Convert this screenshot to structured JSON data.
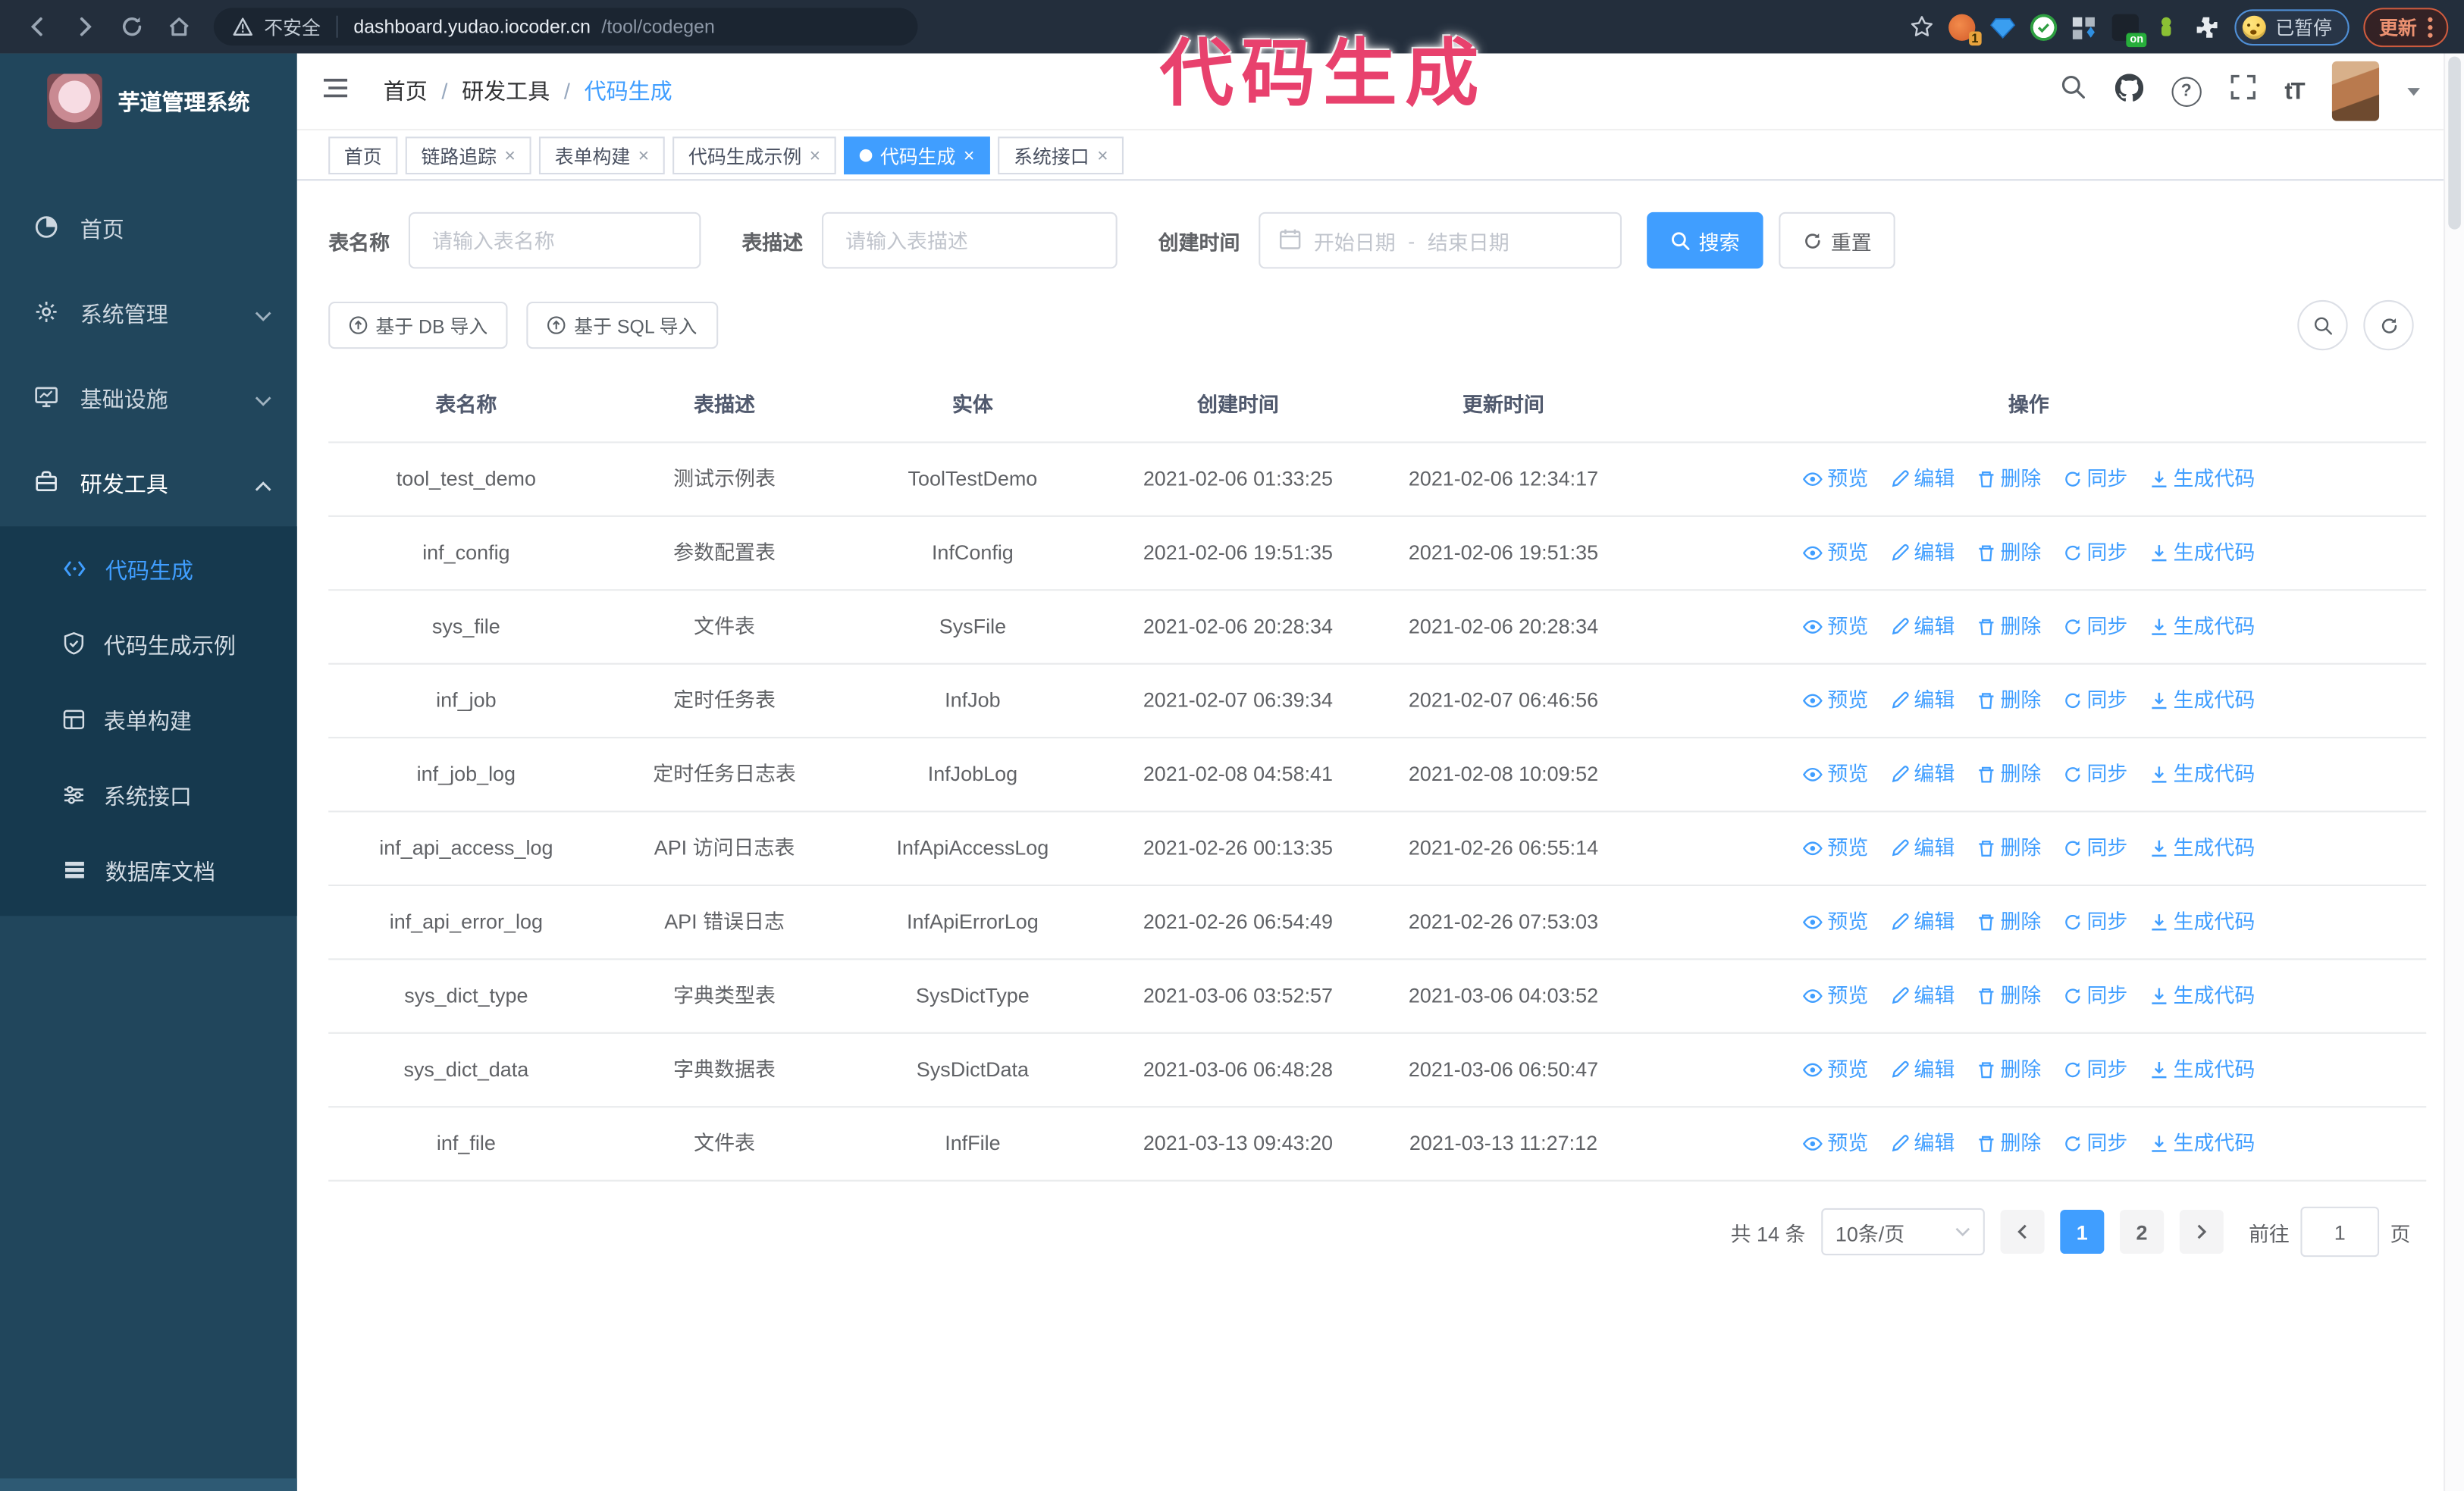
{
  "browser": {
    "security_warning": "不安全",
    "url_domain": "dashboard.yudao.iocoder.cn",
    "url_path": "/tool/codegen",
    "extension_badge": "1",
    "extension_on_label": "on",
    "paused_badge": "已暂停",
    "update_button": "更新"
  },
  "watermark": "代码生成",
  "sidebar": {
    "app_title": "芋道管理系统",
    "items": [
      {
        "label": "首页"
      },
      {
        "label": "系统管理"
      },
      {
        "label": "基础设施"
      },
      {
        "label": "研发工具"
      }
    ],
    "submenu": [
      {
        "label": "代码生成"
      },
      {
        "label": "代码生成示例"
      },
      {
        "label": "表单构建"
      },
      {
        "label": "系统接口"
      },
      {
        "label": "数据库文档"
      }
    ]
  },
  "header": {
    "breadcrumb": [
      "首页",
      "研发工具",
      "代码生成"
    ],
    "breadcrumb_separator": "/",
    "font_size_icon_text": "tT",
    "help_glyph": "?"
  },
  "tabs": {
    "close_glyph": "×",
    "items": [
      {
        "label": "首页"
      },
      {
        "label": "链路追踪"
      },
      {
        "label": "表单构建"
      },
      {
        "label": "代码生成示例"
      },
      {
        "label": "代码生成"
      },
      {
        "label": "系统接口"
      }
    ]
  },
  "filters": {
    "table_name_label": "表名称",
    "table_name_placeholder": "请输入表名称",
    "table_desc_label": "表描述",
    "table_desc_placeholder": "请输入表描述",
    "create_time_label": "创建时间",
    "date_start_placeholder": "开始日期",
    "date_separator": "-",
    "date_end_placeholder": "结束日期",
    "search_button": "搜索",
    "reset_button": "重置"
  },
  "toolbar": {
    "import_db": "基于 DB 导入",
    "import_sql": "基于 SQL 导入"
  },
  "table": {
    "columns": [
      "表名称",
      "表描述",
      "实体",
      "创建时间",
      "更新时间",
      "操作"
    ],
    "actions": [
      "预览",
      "编辑",
      "删除",
      "同步",
      "生成代码"
    ],
    "rows": [
      {
        "name": "tool_test_demo",
        "desc": "测试示例表",
        "entity": "ToolTestDemo",
        "created": "2021-02-06 01:33:25",
        "updated": "2021-02-06 12:34:17"
      },
      {
        "name": "inf_config",
        "desc": "参数配置表",
        "entity": "InfConfig",
        "created": "2021-02-06 19:51:35",
        "updated": "2021-02-06 19:51:35"
      },
      {
        "name": "sys_file",
        "desc": "文件表",
        "entity": "SysFile",
        "created": "2021-02-06 20:28:34",
        "updated": "2021-02-06 20:28:34"
      },
      {
        "name": "inf_job",
        "desc": "定时任务表",
        "entity": "InfJob",
        "created": "2021-02-07 06:39:34",
        "updated": "2021-02-07 06:46:56"
      },
      {
        "name": "inf_job_log",
        "desc": "定时任务日志表",
        "entity": "InfJobLog",
        "created": "2021-02-08 04:58:41",
        "updated": "2021-02-08 10:09:52"
      },
      {
        "name": "inf_api_access_log",
        "desc": "API 访问日志表",
        "entity": "InfApiAccessLog",
        "created": "2021-02-26 00:13:35",
        "updated": "2021-02-26 06:55:14"
      },
      {
        "name": "inf_api_error_log",
        "desc": "API 错误日志",
        "entity": "InfApiErrorLog",
        "created": "2021-02-26 06:54:49",
        "updated": "2021-02-26 07:53:03"
      },
      {
        "name": "sys_dict_type",
        "desc": "字典类型表",
        "entity": "SysDictType",
        "created": "2021-03-06 03:52:57",
        "updated": "2021-03-06 04:03:52"
      },
      {
        "name": "sys_dict_data",
        "desc": "字典数据表",
        "entity": "SysDictData",
        "created": "2021-03-06 06:48:28",
        "updated": "2021-03-06 06:50:47"
      },
      {
        "name": "inf_file",
        "desc": "文件表",
        "entity": "InfFile",
        "created": "2021-03-13 09:43:20",
        "updated": "2021-03-13 11:27:12"
      }
    ]
  },
  "pagination": {
    "total": "共 14 条",
    "page_size": "10条/页",
    "pages": [
      "1",
      "2"
    ],
    "active_page": "1",
    "goto_label": "前往",
    "goto_value": "1",
    "goto_suffix": "页"
  },
  "colors": {
    "primary": "#409eff",
    "sidebar_bg": "#21465c",
    "submenu_bg": "#16394e",
    "chrome_bg": "#232e3c",
    "watermark": "#e8416d"
  }
}
